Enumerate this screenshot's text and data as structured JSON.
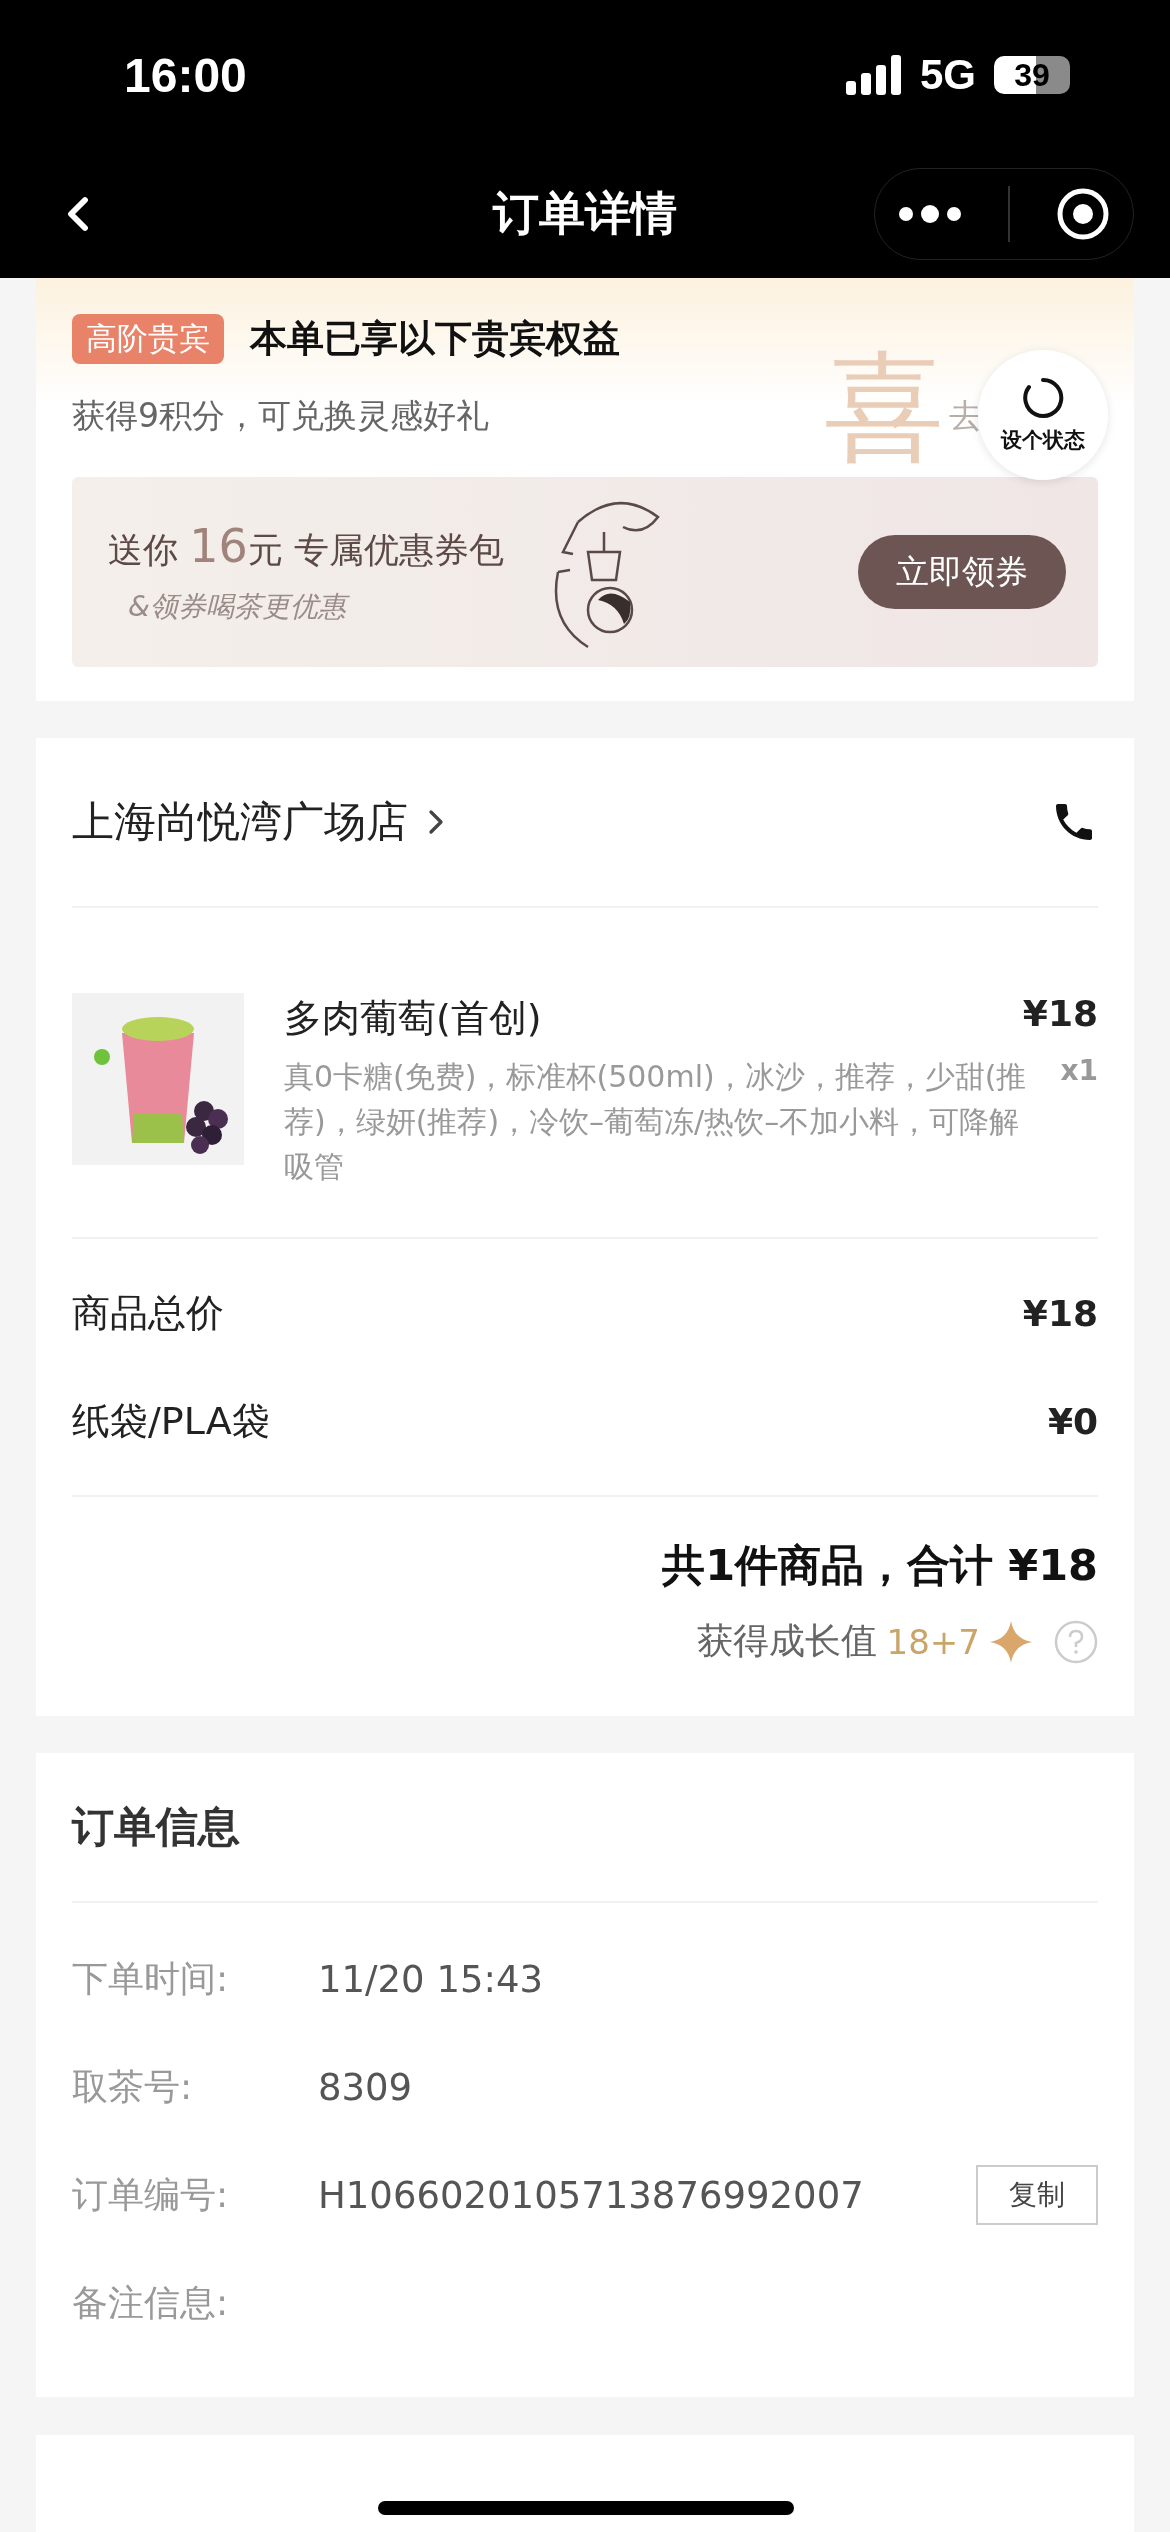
{
  "status_bar": {
    "time": "16:00",
    "network": "5G",
    "battery": "39"
  },
  "nav": {
    "title": "订单详情"
  },
  "vip_card": {
    "badge": "高阶贵宾",
    "heading": "本单已享以下贵宾权益",
    "points_text": "获得9积分，可兑换灵感好礼",
    "link": "去",
    "decor_glyph": "喜",
    "coupon": {
      "prefix": "送你",
      "amount": "16",
      "unit": "元",
      "suffix": "专属优惠券包",
      "subtitle": "&领券喝茶更优惠",
      "button": "立即领券"
    }
  },
  "floating_button": {
    "label": "设个状态"
  },
  "store": {
    "name": "上海尚悦湾广场店"
  },
  "items": [
    {
      "name": "多肉葡萄(首创)",
      "options": "真0卡糖(免费)，标准杯(500ml)，冰沙，推荐，少甜(推荐)，绿妍(推荐)，冷饮–葡萄冻/热饮–不加小料，可降解吸管",
      "price": "¥18",
      "quantity": "x1"
    }
  ],
  "charges": [
    {
      "label": "商品总价",
      "amount": "¥18"
    },
    {
      "label": "纸袋/PLA袋",
      "amount": "¥0"
    }
  ],
  "summary": {
    "total": "共1件商品，合计 ¥18",
    "growth_label": "获得成长值",
    "growth_value": "18+7"
  },
  "order_info": {
    "title": "订单信息",
    "rows": [
      {
        "label": "下单时间:",
        "value": "11/20 15:43"
      },
      {
        "label": "取茶号:",
        "value": "8309"
      },
      {
        "label": "订单编号:",
        "value": "H1066020105713876992007",
        "action": "复制"
      },
      {
        "label": "备注信息:"
      }
    ]
  }
}
